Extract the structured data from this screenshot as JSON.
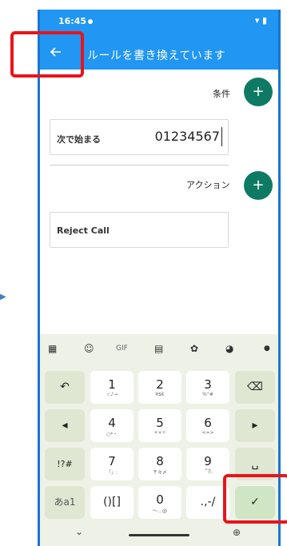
{
  "status": {
    "time": "16:45",
    "icons": "▾ ▮"
  },
  "appbar": {
    "title": "ルールを書き換えています"
  },
  "conditions": {
    "label": "条件",
    "add": "+"
  },
  "condition_field": {
    "label": "次で始まる",
    "value": "01234567"
  },
  "actions": {
    "label": "アクション",
    "add": "+"
  },
  "action_field": {
    "label": "Reject Call"
  },
  "keyboard": {
    "toolbar": {
      "apps": "▦",
      "sticker": "☺",
      "gif": "GIF",
      "clipboard": "▤",
      "settings": "✿",
      "theme": "◕",
      "mic": "●"
    },
    "keys": {
      "undo": "↶",
      "k1": "1",
      "k1s": "☆♪→",
      "k2": "2",
      "k2s": "¥$€",
      "k3": "3",
      "k3s": "%°#",
      "backspace": "⌫",
      "left": "◂",
      "k4": "4",
      "k4s": "○*・",
      "k5": "5",
      "k5s": "+×÷",
      "k6": "6",
      "k6s": "<=>",
      "right": "▸",
      "sym": "!?#",
      "k7": "7",
      "k7s": "「」:",
      "k8": "8",
      "k8s": "〒々〆",
      "k9": "9",
      "k9s": "^|\\",
      "space": "␣",
      "kana": "あa1",
      "brackets": "()[]",
      "k0": "0",
      "k0s": "〜…@",
      "punct": ".,-/",
      "enter": "✓"
    },
    "nav": {
      "hide": "⌄",
      "globe": "⊕"
    }
  },
  "colors": {
    "appbar": "#2196f3",
    "fab": "#0f7a63",
    "annotation": "#e8141c"
  }
}
